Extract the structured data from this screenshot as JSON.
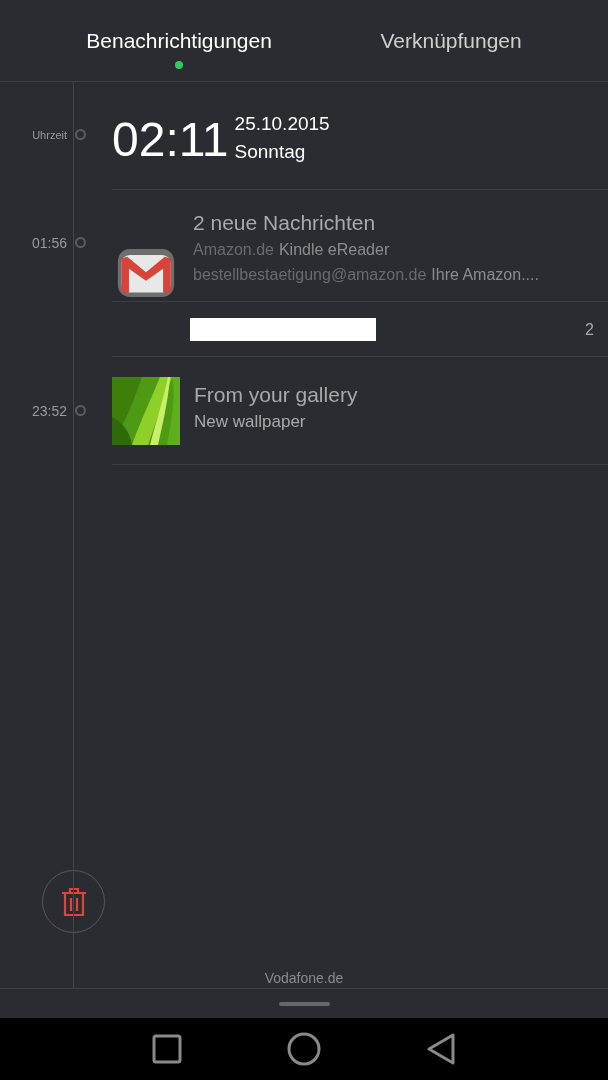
{
  "tabs": [
    {
      "label": "Benachrichtigungen",
      "selected": true
    },
    {
      "label": "Verknüpfungen",
      "selected": false
    }
  ],
  "timeline": [
    {
      "kind": "clock",
      "time_label": "Uhrzeit",
      "clock": "02:11",
      "date": "25.10.2015",
      "weekday": "Sonntag"
    },
    {
      "kind": "group",
      "time_label": "01:56",
      "title": "2 neue Nachrichten",
      "messages": [
        {
          "sender": "Amazon.de",
          "subject": "Kindle eReader"
        },
        {
          "sender": "bestellbestaetigung@amazon.de",
          "subject": "Ihre Amazon...."
        }
      ],
      "count": "2"
    },
    {
      "kind": "single",
      "time_label": "23:52",
      "title": "From your gallery",
      "subtitle": "New wallpaper"
    }
  ],
  "carrier": "Vodafone.de"
}
